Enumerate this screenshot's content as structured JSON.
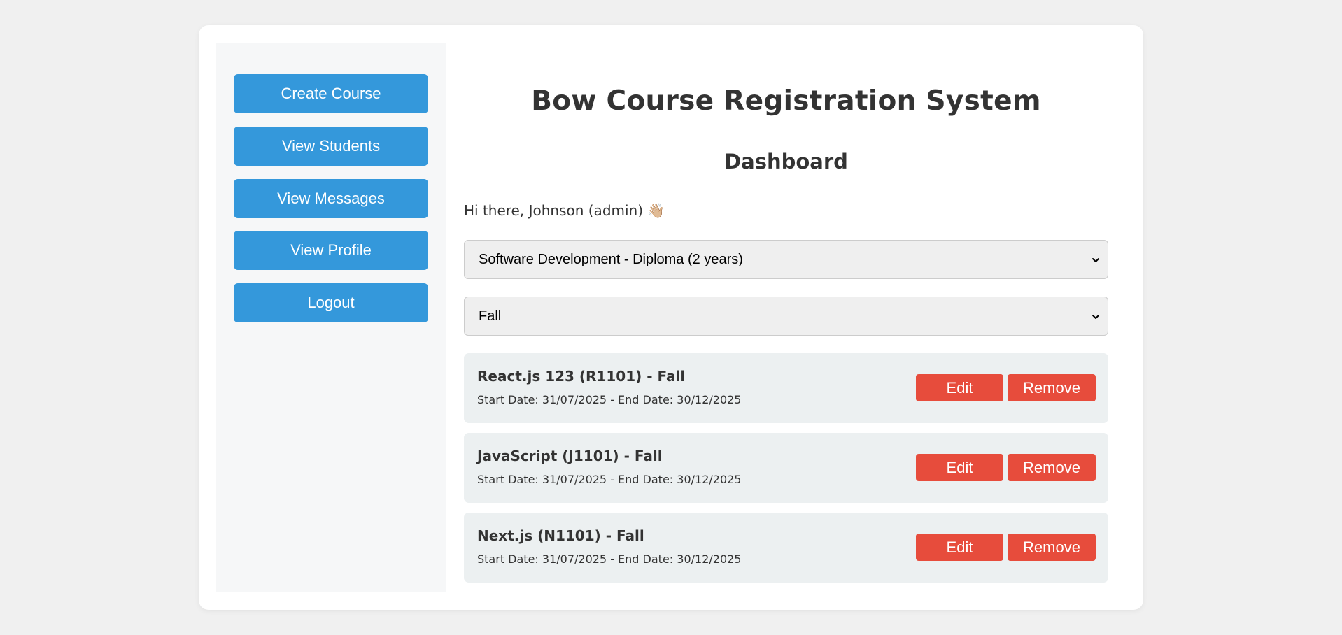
{
  "sidebar": {
    "items": [
      {
        "label": "Create Course"
      },
      {
        "label": "View Students"
      },
      {
        "label": "View Messages"
      },
      {
        "label": "View Profile"
      },
      {
        "label": "Logout"
      }
    ]
  },
  "header": {
    "app_title": "Bow Course Registration System",
    "page_title": "Dashboard"
  },
  "greeting": "Hi there, Johnson (admin) 👋🏼",
  "filters": {
    "program": "Software Development - Diploma (2 years)",
    "term": "Fall"
  },
  "courses": [
    {
      "title": "React.js 123 (R1101) - Fall",
      "dates": "Start Date: 31/07/2025 - End Date: 30/12/2025",
      "edit_label": "Edit",
      "remove_label": "Remove"
    },
    {
      "title": "JavaScript (J1101) - Fall",
      "dates": "Start Date: 31/07/2025 - End Date: 30/12/2025",
      "edit_label": "Edit",
      "remove_label": "Remove"
    },
    {
      "title": "Next.js (N1101) - Fall",
      "dates": "Start Date: 31/07/2025 - End Date: 30/12/2025",
      "edit_label": "Edit",
      "remove_label": "Remove"
    }
  ],
  "colors": {
    "page_bg": "#f0f0f0",
    "primary": "#3498db",
    "danger": "#e74c3c",
    "course_card_bg": "#ecf0f1",
    "text": "#333333"
  },
  "icons": {
    "select_caret": "chevron-down-icon"
  }
}
